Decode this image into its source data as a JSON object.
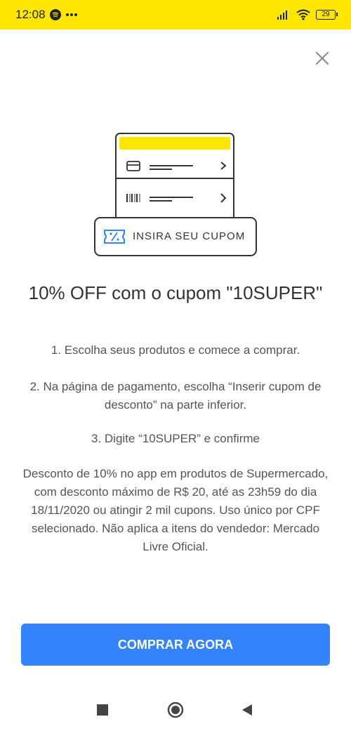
{
  "status_bar": {
    "time": "12:08",
    "battery": "29",
    "icons": [
      "spotify-icon",
      "more-dots-icon",
      "signal-icon",
      "wifi-icon",
      "battery-icon"
    ]
  },
  "close_icon": "close-icon",
  "illustration": {
    "coupon_label": "INSIRA SEU CUPOM",
    "colors": {
      "yellow": "#ffe600",
      "blue": "#3483fa",
      "outline": "#333333"
    },
    "icons": [
      "card-icon",
      "barcode-icon",
      "chevron-right-icon",
      "coupon-icon"
    ]
  },
  "title": "10% OFF com o cupom \"10SUPER\"",
  "steps": {
    "step1": "1. Escolha seus produtos e comece a comprar.",
    "step2": "2. Na página de pagamento, escolha “Inserir cupom de desconto” na parte inferior.",
    "step3": "3. Digite “10SUPER” e confirme"
  },
  "terms": "Desconto de 10% no app em produtos de Supermercado, com desconto máximo de R$ 20, até as 23h59 do dia 18/11/2020 ou atingir 2 mil cupons. Uso único por CPF selecionado. Não aplica a itens do vendedor: Mercado Livre Oficial.",
  "cta_label": "COMPRAR AGORA",
  "cta_color": "#3483fa",
  "navbar": {
    "icons": [
      "recents-square-icon",
      "home-circle-icon",
      "back-triangle-icon"
    ]
  }
}
